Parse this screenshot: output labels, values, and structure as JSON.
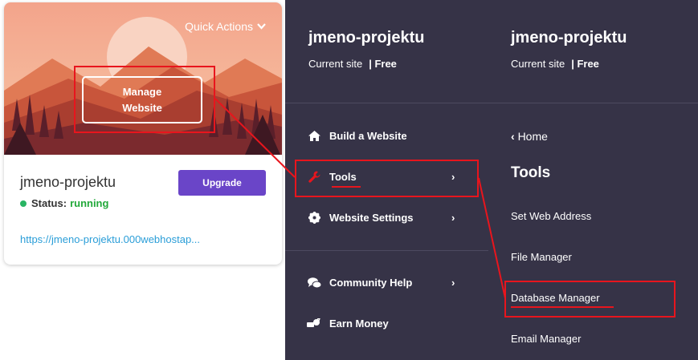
{
  "card": {
    "quick_actions": "Quick Actions",
    "manage_line1": "Manage",
    "manage_line2": "Website",
    "site_name": "jmeno-projektu",
    "status_label": "Status:",
    "status_value": "running",
    "upgrade": "Upgrade",
    "url": "https://jmeno-projektu.000webhostap..."
  },
  "menu": {
    "project": "jmeno-projektu",
    "current_site": "Current site",
    "plan": "| Free",
    "items": [
      {
        "label": "Build a Website",
        "icon": "home-icon"
      },
      {
        "label": "Tools",
        "icon": "wrench-icon"
      },
      {
        "label": "Website Settings",
        "icon": "gear-icon"
      },
      {
        "label": "Community Help",
        "icon": "chat-icon"
      },
      {
        "label": "Earn Money",
        "icon": "money-icon"
      }
    ]
  },
  "submenu": {
    "project": "jmeno-projektu",
    "current_site": "Current site",
    "plan": "| Free",
    "home": "Home",
    "title": "Tools",
    "items": [
      "Set Web Address",
      "File Manager",
      "Database Manager",
      "Email Manager"
    ]
  },
  "colors": {
    "panel_bg": "#363347",
    "highlight": "#e8151d",
    "upgrade_bg": "#6a45c8",
    "status_green": "#22a93a",
    "link": "#2b9ed8"
  }
}
